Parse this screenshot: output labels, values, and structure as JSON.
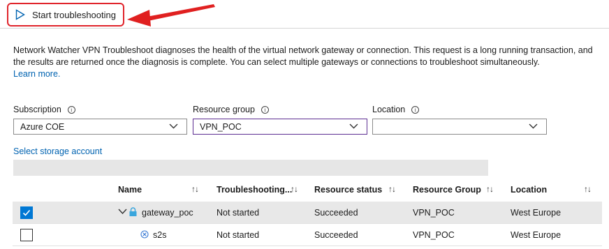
{
  "toolbar": {
    "start_label": "Start troubleshooting"
  },
  "description": {
    "text": "Network Watcher VPN Troubleshoot diagnoses the health of the virtual network gateway or connection. This request is a long running transaction, and the results are returned once the diagnosis is complete. You can select multiple gateways or connections to troubleshoot simultaneously.",
    "learn_more": "Learn more."
  },
  "filters": {
    "subscription": {
      "label": "Subscription",
      "value": "Azure COE"
    },
    "resource_group": {
      "label": "Resource group",
      "value": "VPN_POC"
    },
    "location": {
      "label": "Location",
      "value": ""
    }
  },
  "storage": {
    "link_label": "Select storage account",
    "value": ""
  },
  "table": {
    "columns": {
      "name": "Name",
      "troubleshooting": "Troubleshooting...",
      "resource_status": "Resource status",
      "resource_group": "Resource Group",
      "location": "Location"
    },
    "rows": [
      {
        "name": "gateway_poc",
        "troubleshooting": "Not started",
        "resource_status": "Succeeded",
        "resource_group": "VPN_POC",
        "location": "West Europe",
        "checked": true
      },
      {
        "name": "s2s",
        "troubleshooting": "Not started",
        "resource_status": "Succeeded",
        "resource_group": "VPN_POC",
        "location": "West Europe",
        "checked": false
      }
    ]
  },
  "colors": {
    "highlight_red": "#e0242b",
    "link_blue": "#0063b1",
    "checkbox_blue": "#0078d4"
  },
  "icons": {
    "start": "play-outline-icon",
    "gateway": "vpn-gateway-lock-icon",
    "connection": "connection-icon"
  }
}
